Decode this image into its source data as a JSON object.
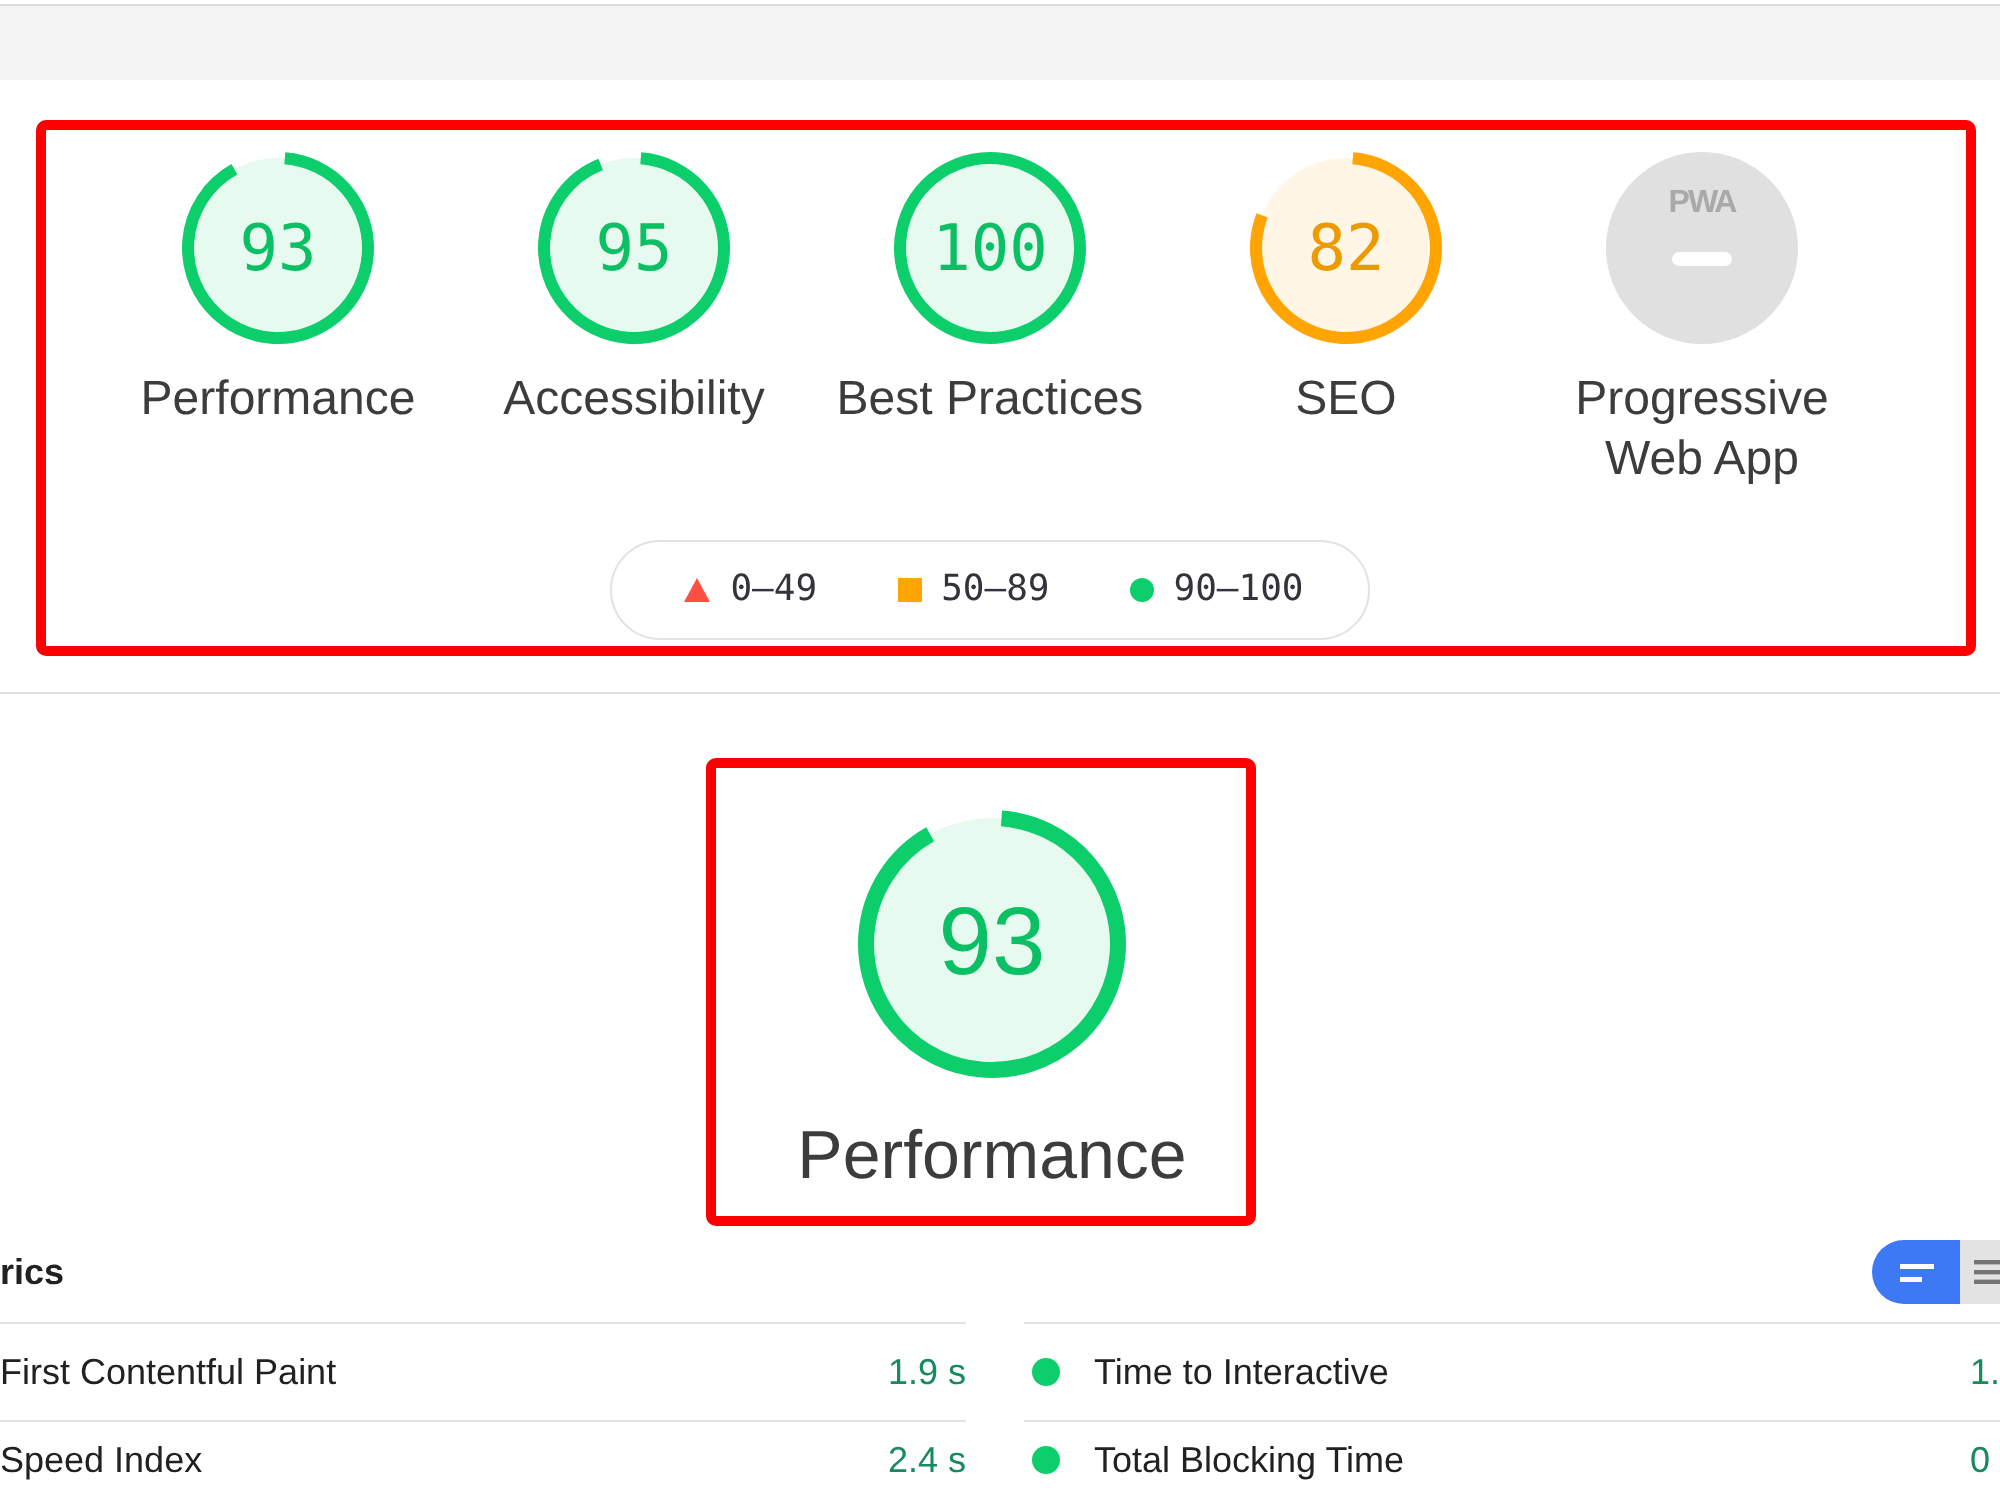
{
  "categories_section": {
    "highlighted": true,
    "gauges": [
      {
        "kind": "score",
        "score": "93",
        "color": "#0cce6b",
        "label": "Performance"
      },
      {
        "kind": "score",
        "score": "95",
        "color": "#0cce6b",
        "label": "Accessibility"
      },
      {
        "kind": "score",
        "score": "100",
        "color": "#0cce6b",
        "label": "Best Practices"
      },
      {
        "kind": "score",
        "score": "82",
        "color": "#ffa400",
        "label": "SEO"
      },
      {
        "kind": "pwa",
        "badge": "PWA",
        "label": "Progressive Web App"
      }
    ],
    "legend": [
      {
        "kind": "triangle",
        "color": "#ff4e42",
        "range": "0–49"
      },
      {
        "kind": "square",
        "color": "#ffa400",
        "range": "50–89"
      },
      {
        "kind": "circle",
        "color": "#0cce6b",
        "range": "90–100"
      }
    ]
  },
  "performance_gauge": {
    "highlighted": true,
    "score": "93",
    "color": "#0cce6b",
    "label": "Performance"
  },
  "metrics": {
    "title": "rics",
    "view_toggle": [
      {
        "kind": "summary",
        "selected": true
      },
      {
        "kind": "list",
        "selected": false
      }
    ],
    "columns": [
      {
        "rows": [
          {
            "label": "First Contentful Paint",
            "value": "1.9 s",
            "dot": false
          },
          {
            "label": "Speed Index",
            "value": "2.4 s",
            "dot": false
          }
        ]
      },
      {
        "rows": [
          {
            "label": "Time to Interactive",
            "value": "1.",
            "dot": true
          },
          {
            "label": "Total Blocking Time",
            "value": "0",
            "dot": true
          }
        ]
      }
    ]
  }
}
